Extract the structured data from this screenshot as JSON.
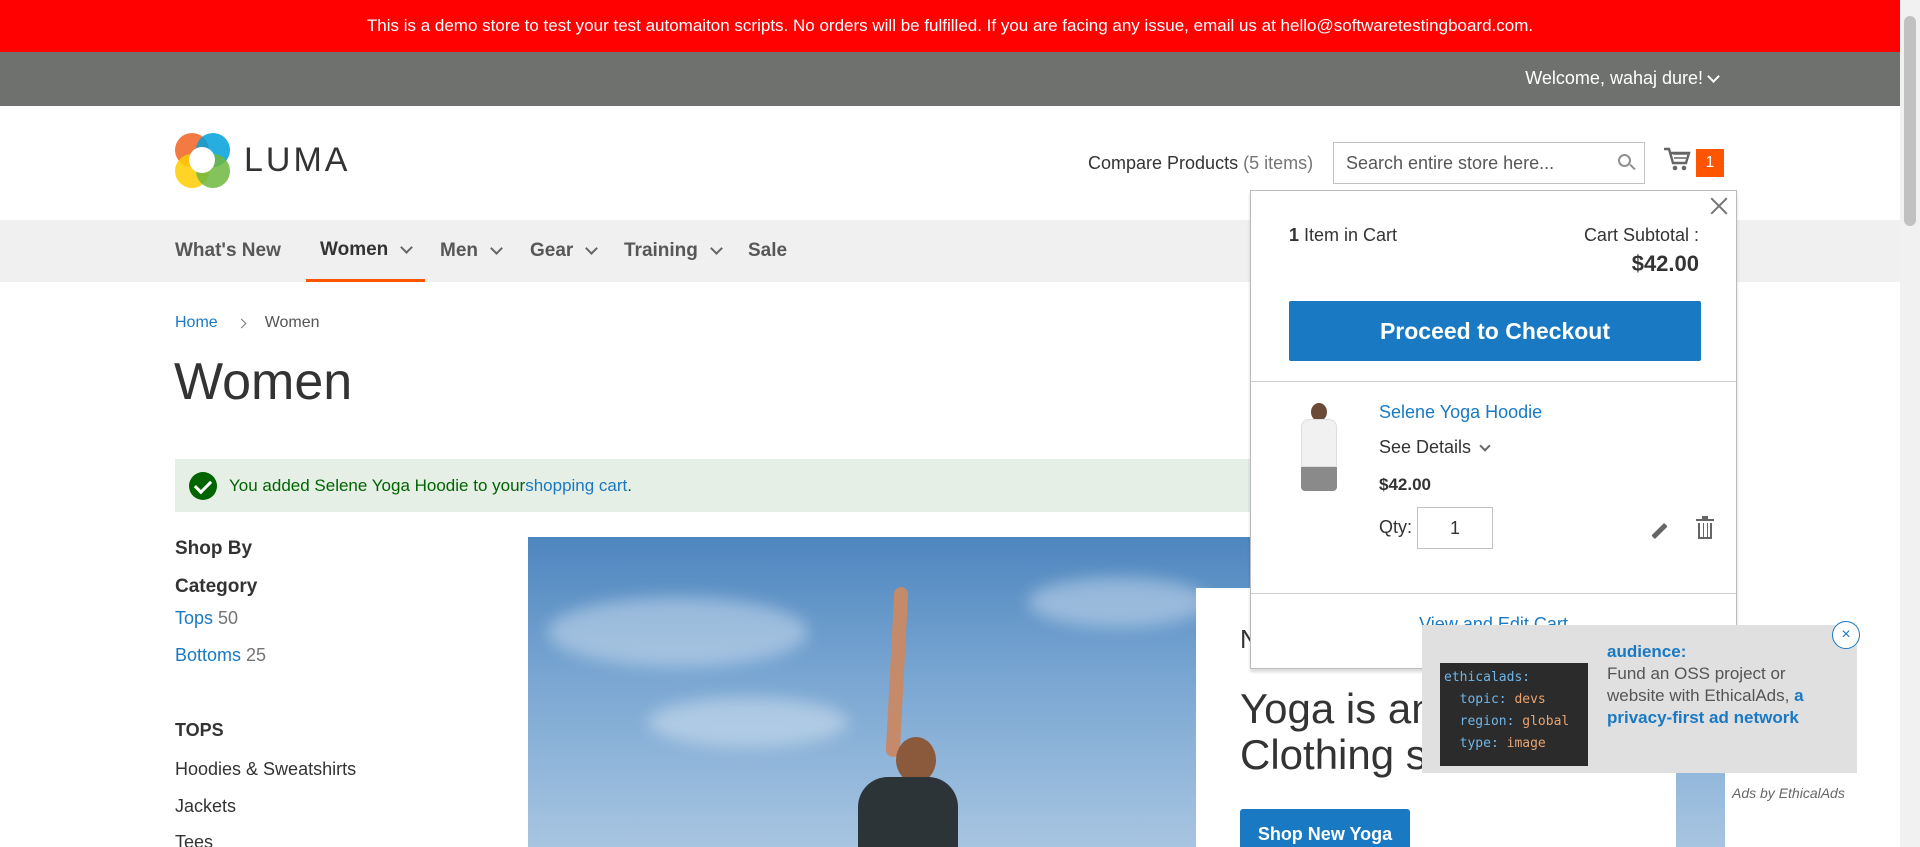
{
  "banner": {
    "text": "This is a demo store to test your test automaiton scripts. No orders will be fulfilled. If you are facing any issue, email us at hello@softwaretestingboard.com."
  },
  "panel": {
    "welcome": "Welcome, wahaj dure!"
  },
  "header": {
    "logo": "LUMA",
    "compare_label": "Compare Products",
    "compare_count": "(5 items)",
    "search_placeholder": "Search entire store here...",
    "cart_count": "1"
  },
  "nav": {
    "items": [
      {
        "label": "What's New",
        "dropdown": false
      },
      {
        "label": "Women",
        "dropdown": true,
        "active": true
      },
      {
        "label": "Men",
        "dropdown": true
      },
      {
        "label": "Gear",
        "dropdown": true
      },
      {
        "label": "Training",
        "dropdown": true
      },
      {
        "label": "Sale",
        "dropdown": false
      }
    ]
  },
  "breadcrumb": {
    "home": "Home",
    "current": "Women"
  },
  "page": {
    "title": "Women"
  },
  "message": {
    "prefix": "You added Selene Yoga Hoodie to your ",
    "link": "shopping cart",
    "suffix": "."
  },
  "sidebar": {
    "shop_by": "Shop By",
    "category": "Category",
    "categories": [
      {
        "label": "Tops",
        "count": "50"
      },
      {
        "label": "Bottoms",
        "count": "25"
      }
    ],
    "tops_heading": "TOPS",
    "tops_items": [
      "Hoodies & Sweatshirts",
      "Jackets",
      "Tees"
    ]
  },
  "hero": {
    "pre": "N",
    "headline_1": "Yoga is anc",
    "headline_2": "Clothing sh",
    "button": "Shop New Yoga"
  },
  "minicart": {
    "count_num": "1",
    "count_text": "Item in Cart",
    "subtotal_label": "Cart Subtotal :",
    "subtotal_value": "$42.00",
    "checkout_button": "Proceed to Checkout",
    "product_name": "Selene Yoga Hoodie",
    "see_details": "See Details",
    "price": "$42.00",
    "qty_label": "Qty:",
    "qty_value": "1",
    "view_cart": "View and Edit Cart"
  },
  "ad": {
    "code_lines": [
      {
        "key": "ethicalads:",
        "value": ""
      },
      {
        "key": "topic:",
        "value": "devs"
      },
      {
        "key": "region:",
        "value": "global"
      },
      {
        "key": "type:",
        "value": "image"
      }
    ],
    "lead": "audience:",
    "body": "Fund an OSS project or website with EthicalAds,",
    "link": "a privacy-first ad network",
    "by": "Ads by EthicalAds",
    "close": "×"
  },
  "colors": {
    "banner_red": "#ff0101",
    "accent_orange": "#ff5501",
    "link_blue": "#1979c3",
    "panel_gray": "#6e716e"
  }
}
